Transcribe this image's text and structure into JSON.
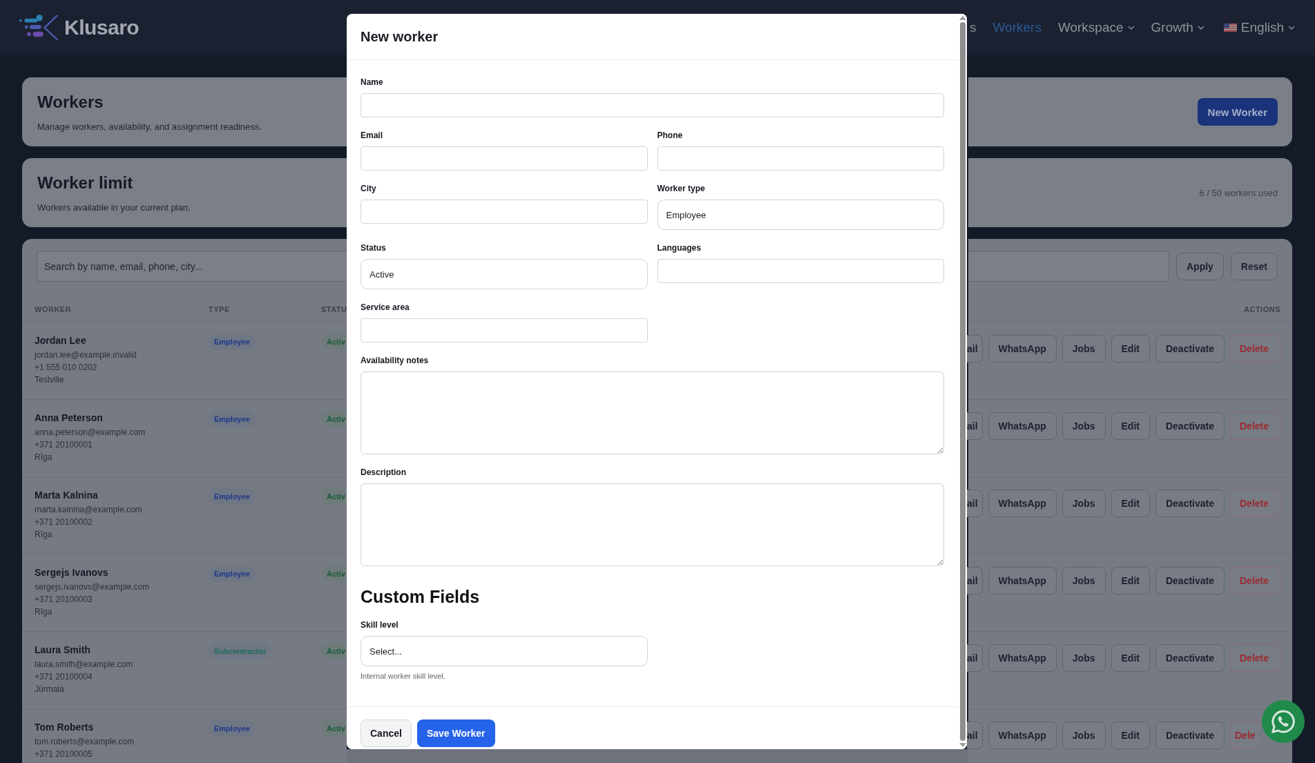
{
  "nav": {
    "logo": "Klusaro",
    "items": [
      {
        "label": "s",
        "selected": false,
        "dropdown": false
      },
      {
        "label": "Workers",
        "selected": true,
        "dropdown": false
      },
      {
        "label": "Workspace",
        "selected": false,
        "dropdown": true
      },
      {
        "label": "Growth",
        "selected": false,
        "dropdown": true
      }
    ],
    "language": {
      "label": "English",
      "dropdown": true
    }
  },
  "header_card": {
    "title": "Workers",
    "subtitle": "Manage workers, availability, and assignment readiness.",
    "button": "New Worker"
  },
  "limit_card": {
    "title": "Worker limit",
    "subtitle": "Workers available in your current plan.",
    "usage": "6 / 50 workers used"
  },
  "filters": {
    "search_placeholder": "Search by name, email, phone, city...",
    "buttons": [
      "Apply",
      "Reset"
    ]
  },
  "table": {
    "columns": [
      "WORKER",
      "TYPE",
      "STATU",
      "ACTIONS"
    ],
    "rows": [
      {
        "name": "Jordan Lee",
        "email": "jordan.lee@example.invalid",
        "phone": "+1 555 010 0202",
        "city": "Testville",
        "type": {
          "label": "Employee",
          "color": "#1e3a8a"
        },
        "status": "Activ",
        "actions": [
          {
            "label": "ail",
            "kind": "default"
          },
          {
            "label": "WhatsApp",
            "kind": "default"
          },
          {
            "label": "Jobs",
            "kind": "default"
          },
          {
            "label": "Edit",
            "kind": "default"
          },
          {
            "label": "Deactivate",
            "kind": "default"
          },
          {
            "label": "Delete",
            "kind": "danger"
          }
        ]
      },
      {
        "name": "Anna Peterson",
        "email": "anna.peterson@example.com",
        "phone": "+371 20100001",
        "city": "Rīga",
        "type": {
          "label": "Employee",
          "color": "#1e3a8a"
        },
        "status": "Activ",
        "actions": [
          {
            "label": "ail",
            "kind": "default"
          },
          {
            "label": "WhatsApp",
            "kind": "default"
          },
          {
            "label": "Jobs",
            "kind": "default"
          },
          {
            "label": "Edit",
            "kind": "default"
          },
          {
            "label": "Deactivate",
            "kind": "default"
          },
          {
            "label": "Delete",
            "kind": "danger"
          }
        ]
      },
      {
        "name": "Marta Kalnina",
        "email": "marta.kalnina@example.com",
        "phone": "+371 20100002",
        "city": "Rīga",
        "type": {
          "label": "Employee",
          "color": "#1e3a8a"
        },
        "status": "Activ",
        "actions": [
          {
            "label": "ail",
            "kind": "default"
          },
          {
            "label": "WhatsApp",
            "kind": "default"
          },
          {
            "label": "Jobs",
            "kind": "default"
          },
          {
            "label": "Edit",
            "kind": "default"
          },
          {
            "label": "Deactivate",
            "kind": "default"
          },
          {
            "label": "Delete",
            "kind": "danger"
          }
        ]
      },
      {
        "name": "Sergejs Ivanovs",
        "email": "sergejs.ivanovs@example.com",
        "phone": "+371 20100003",
        "city": "Rīga",
        "type": {
          "label": "Employee",
          "color": "#1e3a8a"
        },
        "status": "Activ",
        "actions": [
          {
            "label": "ail",
            "kind": "default"
          },
          {
            "label": "WhatsApp",
            "kind": "default"
          },
          {
            "label": "Jobs",
            "kind": "default"
          },
          {
            "label": "Edit",
            "kind": "default"
          },
          {
            "label": "Deactivate",
            "kind": "default"
          },
          {
            "label": "Delete",
            "kind": "danger"
          }
        ]
      },
      {
        "name": "Laura Smith",
        "email": "laura.smith@example.com",
        "phone": "+371 20100004",
        "city": "Jūrmala",
        "type": {
          "label": "Subcontractor",
          "color": "#1d6b57"
        },
        "status": "Activ",
        "actions": [
          {
            "label": "ail",
            "kind": "default"
          },
          {
            "label": "WhatsApp",
            "kind": "default"
          },
          {
            "label": "Jobs",
            "kind": "default"
          },
          {
            "label": "Edit",
            "kind": "default"
          },
          {
            "label": "Deactivate",
            "kind": "default"
          },
          {
            "label": "Delete",
            "kind": "danger"
          }
        ]
      },
      {
        "name": "Tom Roberts",
        "email": "tom.roberts@example.com",
        "phone": "+371 20100005",
        "type": {
          "label": "Employee",
          "color": "#1e3a8a"
        },
        "status": "Activ",
        "actions": [
          {
            "label": "ail",
            "kind": "default"
          },
          {
            "label": "WhatsApp",
            "kind": "default"
          },
          {
            "label": "Jobs",
            "kind": "default"
          },
          {
            "label": "Edit",
            "kind": "default"
          },
          {
            "label": "Deactivate",
            "kind": "default"
          },
          {
            "label": "Dele",
            "kind": "danger_cut"
          }
        ]
      }
    ]
  },
  "modal": {
    "title": "New worker",
    "fields": [
      {
        "label": "Name",
        "kind": "input",
        "wide": true
      },
      {
        "label": "Email",
        "kind": "input",
        "wide": false
      },
      {
        "label": "Phone",
        "kind": "input",
        "wide": false
      },
      {
        "label": "City",
        "kind": "input",
        "wide": false
      },
      {
        "label": "Worker type",
        "kind": "select",
        "wide": false,
        "value": "Employee"
      },
      {
        "label": "Status",
        "kind": "select",
        "wide": false,
        "value": "Active"
      },
      {
        "label": "Languages",
        "kind": "input",
        "wide": false
      },
      {
        "label": "Service area",
        "kind": "input",
        "wide": false
      },
      {
        "label": "Availability notes",
        "kind": "textarea",
        "wide": true
      },
      {
        "label": "Description",
        "kind": "textarea",
        "wide": true
      }
    ],
    "custom": {
      "title": "Custom Fields",
      "fields": [
        {
          "label": "Skill level",
          "kind": "select",
          "wide": false,
          "value": "Select...",
          "help": "Internal worker skill level."
        }
      ]
    },
    "buttons": [
      {
        "label": "Cancel",
        "kind": "secondary"
      },
      {
        "label": "Save Worker",
        "kind": "primary"
      }
    ]
  }
}
